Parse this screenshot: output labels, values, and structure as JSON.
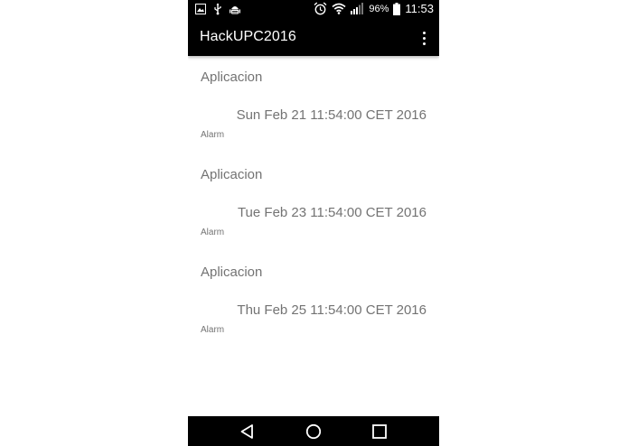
{
  "status_bar": {
    "battery_percent": "96%",
    "time": "11:53",
    "icons": [
      "gallery-icon",
      "usb-icon",
      "android-debug-icon",
      "alarm-icon",
      "wifi-icon",
      "signal-icon",
      "battery-icon"
    ]
  },
  "app_bar": {
    "title": "HackUPC2016",
    "overflow_icon": "more-vert-icon"
  },
  "items": [
    {
      "title": "Aplicacion",
      "date": "Sun Feb 21 11:54:00 CET 2016",
      "type": "Alarm"
    },
    {
      "title": "Aplicacion",
      "date": "Tue Feb 23 11:54:00 CET 2016",
      "type": "Alarm"
    },
    {
      "title": "Aplicacion",
      "date": "Thu Feb 25 11:54:00 CET 2016",
      "type": "Alarm"
    }
  ],
  "nav_bar": {
    "icons": [
      "back-icon",
      "home-icon",
      "recents-icon"
    ]
  },
  "colors": {
    "bar_background": "#000000",
    "text_gray": "#737373",
    "background": "#ffffff"
  }
}
